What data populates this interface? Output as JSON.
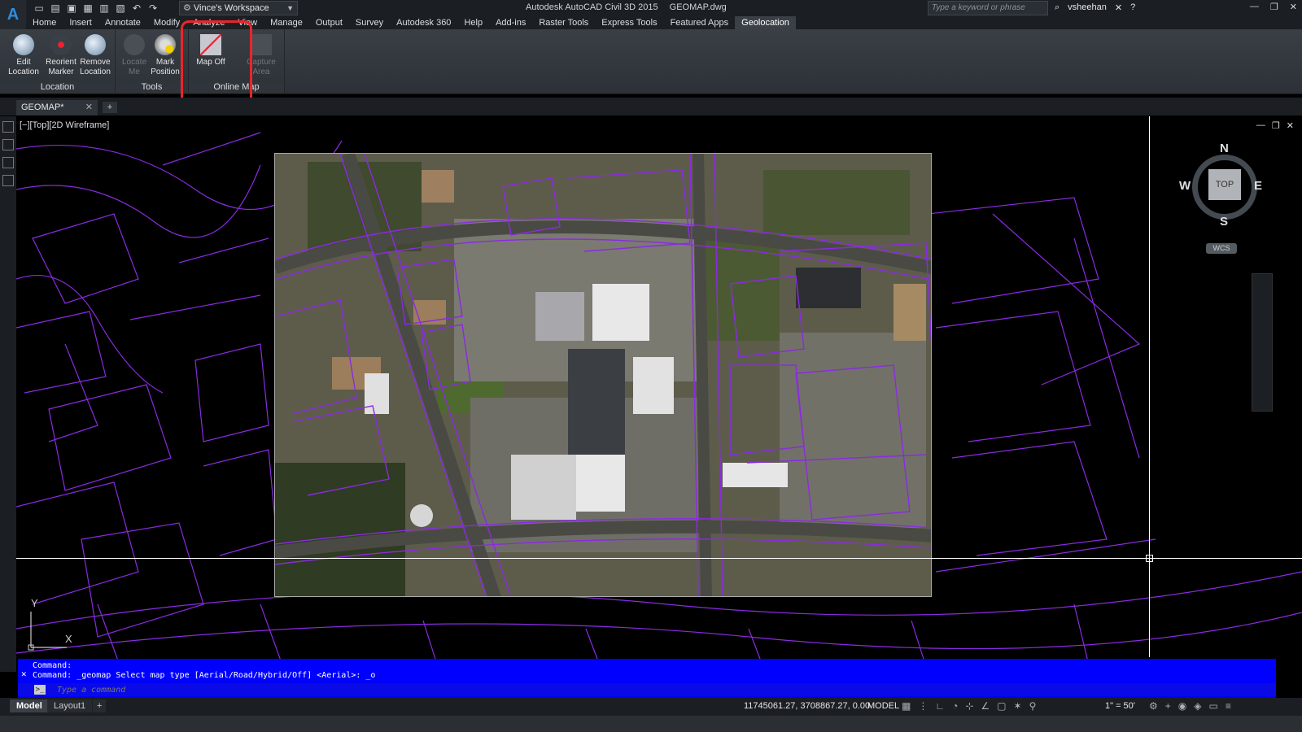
{
  "window": {
    "app_name": "Autodesk AutoCAD Civil 3D 2015",
    "file_name": "GEOMAP.dwg",
    "workspace": "Vince's Workspace",
    "search_placeholder": "Type a keyword or phrase",
    "user": "vsheehan"
  },
  "menu": {
    "tabs": [
      "Home",
      "Insert",
      "Annotate",
      "Modify",
      "Analyze",
      "View",
      "Manage",
      "Output",
      "Survey",
      "Autodesk 360",
      "Help",
      "Add-ins",
      "Raster Tools",
      "Express Tools",
      "Featured Apps",
      "Geolocation"
    ],
    "active": "Geolocation"
  },
  "ribbon": {
    "location_panel": {
      "title": "Location",
      "edit": "Edit Location",
      "reorient": "Reorient Marker",
      "remove": "Remove Location"
    },
    "tools_panel": {
      "title": "Tools",
      "locate_me": "Locate Me",
      "mark_position": "Mark Position"
    },
    "online_map_panel": {
      "title": "Online Map",
      "map_off": "Map Off",
      "capture_area": "Capture Area"
    }
  },
  "file_tabs": {
    "active": "GEOMAP*"
  },
  "viewport": {
    "label": "[−][Top][2D Wireframe]",
    "viewcube": {
      "top": "TOP",
      "n": "N",
      "s": "S",
      "e": "E",
      "w": "W",
      "wcs": "WCS"
    },
    "ucs": {
      "x": "X",
      "y": "Y"
    }
  },
  "command": {
    "line1": "Command:",
    "line2": "Command: _geomap Select map type [Aerial/Road/Hybrid/Off] <Aerial>: _o",
    "placeholder": "Type a command"
  },
  "status": {
    "layouts": [
      "Model",
      "Layout1"
    ],
    "coords": "11745061.27, 3708867.27, 0.00",
    "space": "MODEL",
    "scale": "1\" = 50'"
  }
}
